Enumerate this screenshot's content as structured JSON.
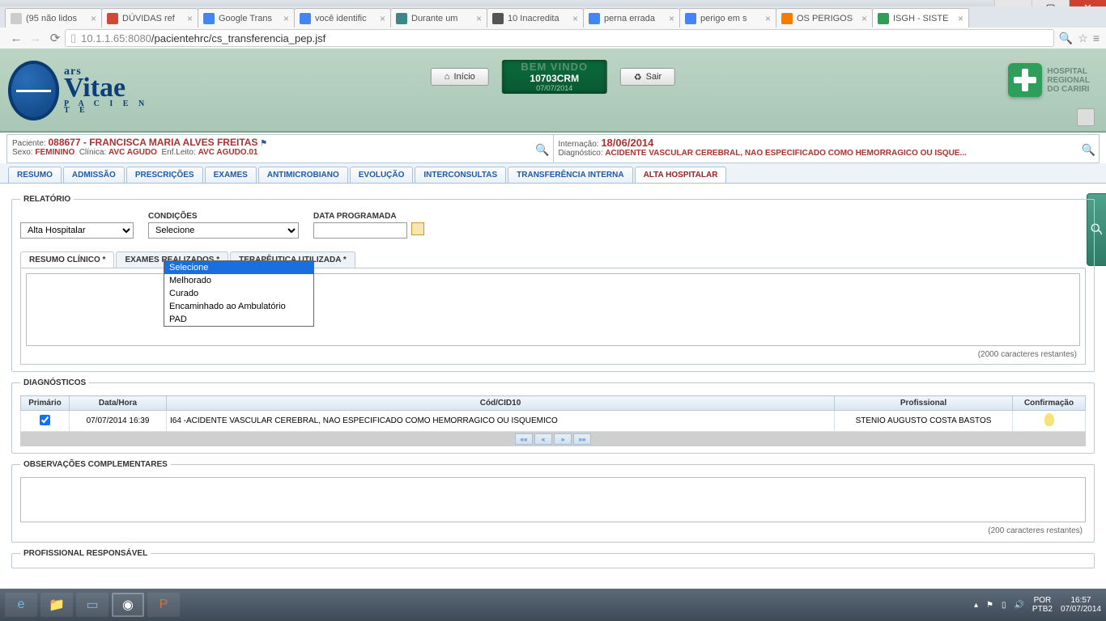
{
  "browser": {
    "tabs": [
      {
        "title": "(95 não lidos",
        "fav": "#ccc"
      },
      {
        "title": "DÚVIDAS ref",
        "fav": "#d14836"
      },
      {
        "title": "Google Trans",
        "fav": "#4285f4"
      },
      {
        "title": "você identific",
        "fav": "#4285f4"
      },
      {
        "title": "Durante um",
        "fav": "#3b8686"
      },
      {
        "title": "10 Inacredita",
        "fav": "#555"
      },
      {
        "title": "perna errada",
        "fav": "#4285f4"
      },
      {
        "title": "perigo em s",
        "fav": "#4285f4"
      },
      {
        "title": "OS PERIGOS",
        "fav": "#f57c00"
      },
      {
        "title": "ISGH - SISTE",
        "fav": "#2e9e5b",
        "active": true
      }
    ],
    "url_host": "10.1.1.65",
    "url_port": ":8080",
    "url_path": "/pacientehrc/cs_transferencia_pep.jsf"
  },
  "header": {
    "logo_ars": "ars",
    "logo_main": "Vitae",
    "logo_sub": "P A C I E N T E",
    "inicio": "Início",
    "sair": "Sair",
    "crm_bem": "BEM VINDO",
    "crm_code": "10703CRM",
    "crm_date": "07/07/2014",
    "hospital_l1": "HOSPITAL",
    "hospital_l2": "REGIONAL",
    "hospital_l3": "DO CARIRI"
  },
  "patient": {
    "left_label": "Paciente:",
    "id": "088677",
    "sep": " - ",
    "name": "FRANCISCA MARIA ALVES FREITAS",
    "sexo_lbl": "Sexo:",
    "sexo": "FEMININO",
    "clinica_lbl": "Clínica:",
    "clinica": "AVC AGUDO",
    "enf_lbl": "Enf.Leito:",
    "enf": "AVC AGUDO.01",
    "intern_lbl": "Internação:",
    "intern": "18/06/2014",
    "diag_lbl": "Diagnóstico:",
    "diag": "ACIDENTE VASCULAR CEREBRAL, NAO ESPECIFICADO COMO HEMORRAGICO OU ISQUE..."
  },
  "app_tabs": [
    "RESUMO",
    "ADMISSÃO",
    "PRESCRIÇÕES",
    "EXAMES",
    "ANTIMICROBIANO",
    "EVOLUÇÃO",
    "INTERCONSULTAS",
    "TRANSFERÊNCIA INTERNA",
    "ALTA HOSPITALAR"
  ],
  "app_tab_active": 8,
  "relatorio": {
    "legend": "RELATÓRIO",
    "tipo_value": "Alta Hospitalar",
    "cond_label": "CONDIÇÕES",
    "cond_value": "Selecione",
    "cond_options": [
      "Selecione",
      "Melhorado",
      "Curado",
      "Encaminhado ao Ambulatório",
      "PAD"
    ],
    "cond_highlight": 0,
    "data_label": "DATA PROGRAMADA",
    "data_value": ""
  },
  "sub_tabs": [
    "RESUMO CLÍNICO *",
    "EXAMES REALIZADOS *",
    "TERAPÊUTICA UTILIZADA *"
  ],
  "sub_tab_active": 0,
  "resumo_remaining": "(2000 caracteres restantes)",
  "diagnosticos": {
    "legend": "DIAGNÓSTICOS",
    "headers": [
      "Primário",
      "Data/Hora",
      "Cód/CID10",
      "Profissional",
      "Confirmação"
    ],
    "rows": [
      {
        "primario": true,
        "datahora": "07/07/2014 16:39",
        "cid": "I64 -ACIDENTE VASCULAR CEREBRAL, NAO ESPECIFICADO COMO HEMORRAGICO OU ISQUEMICO",
        "prof": "STENIO AUGUSTO COSTA BASTOS"
      }
    ],
    "pager": [
      "««",
      "«",
      "»",
      "»»"
    ]
  },
  "obs": {
    "legend": "OBSERVAÇÕES COMPLEMENTARES",
    "remaining": "(200 caracteres restantes)"
  },
  "prof": {
    "legend": "PROFISSIONAL RESPONSÁVEL"
  },
  "taskbar": {
    "lang": "POR",
    "kbd": "PTB2",
    "time": "16:57",
    "date": "07/07/2014"
  }
}
